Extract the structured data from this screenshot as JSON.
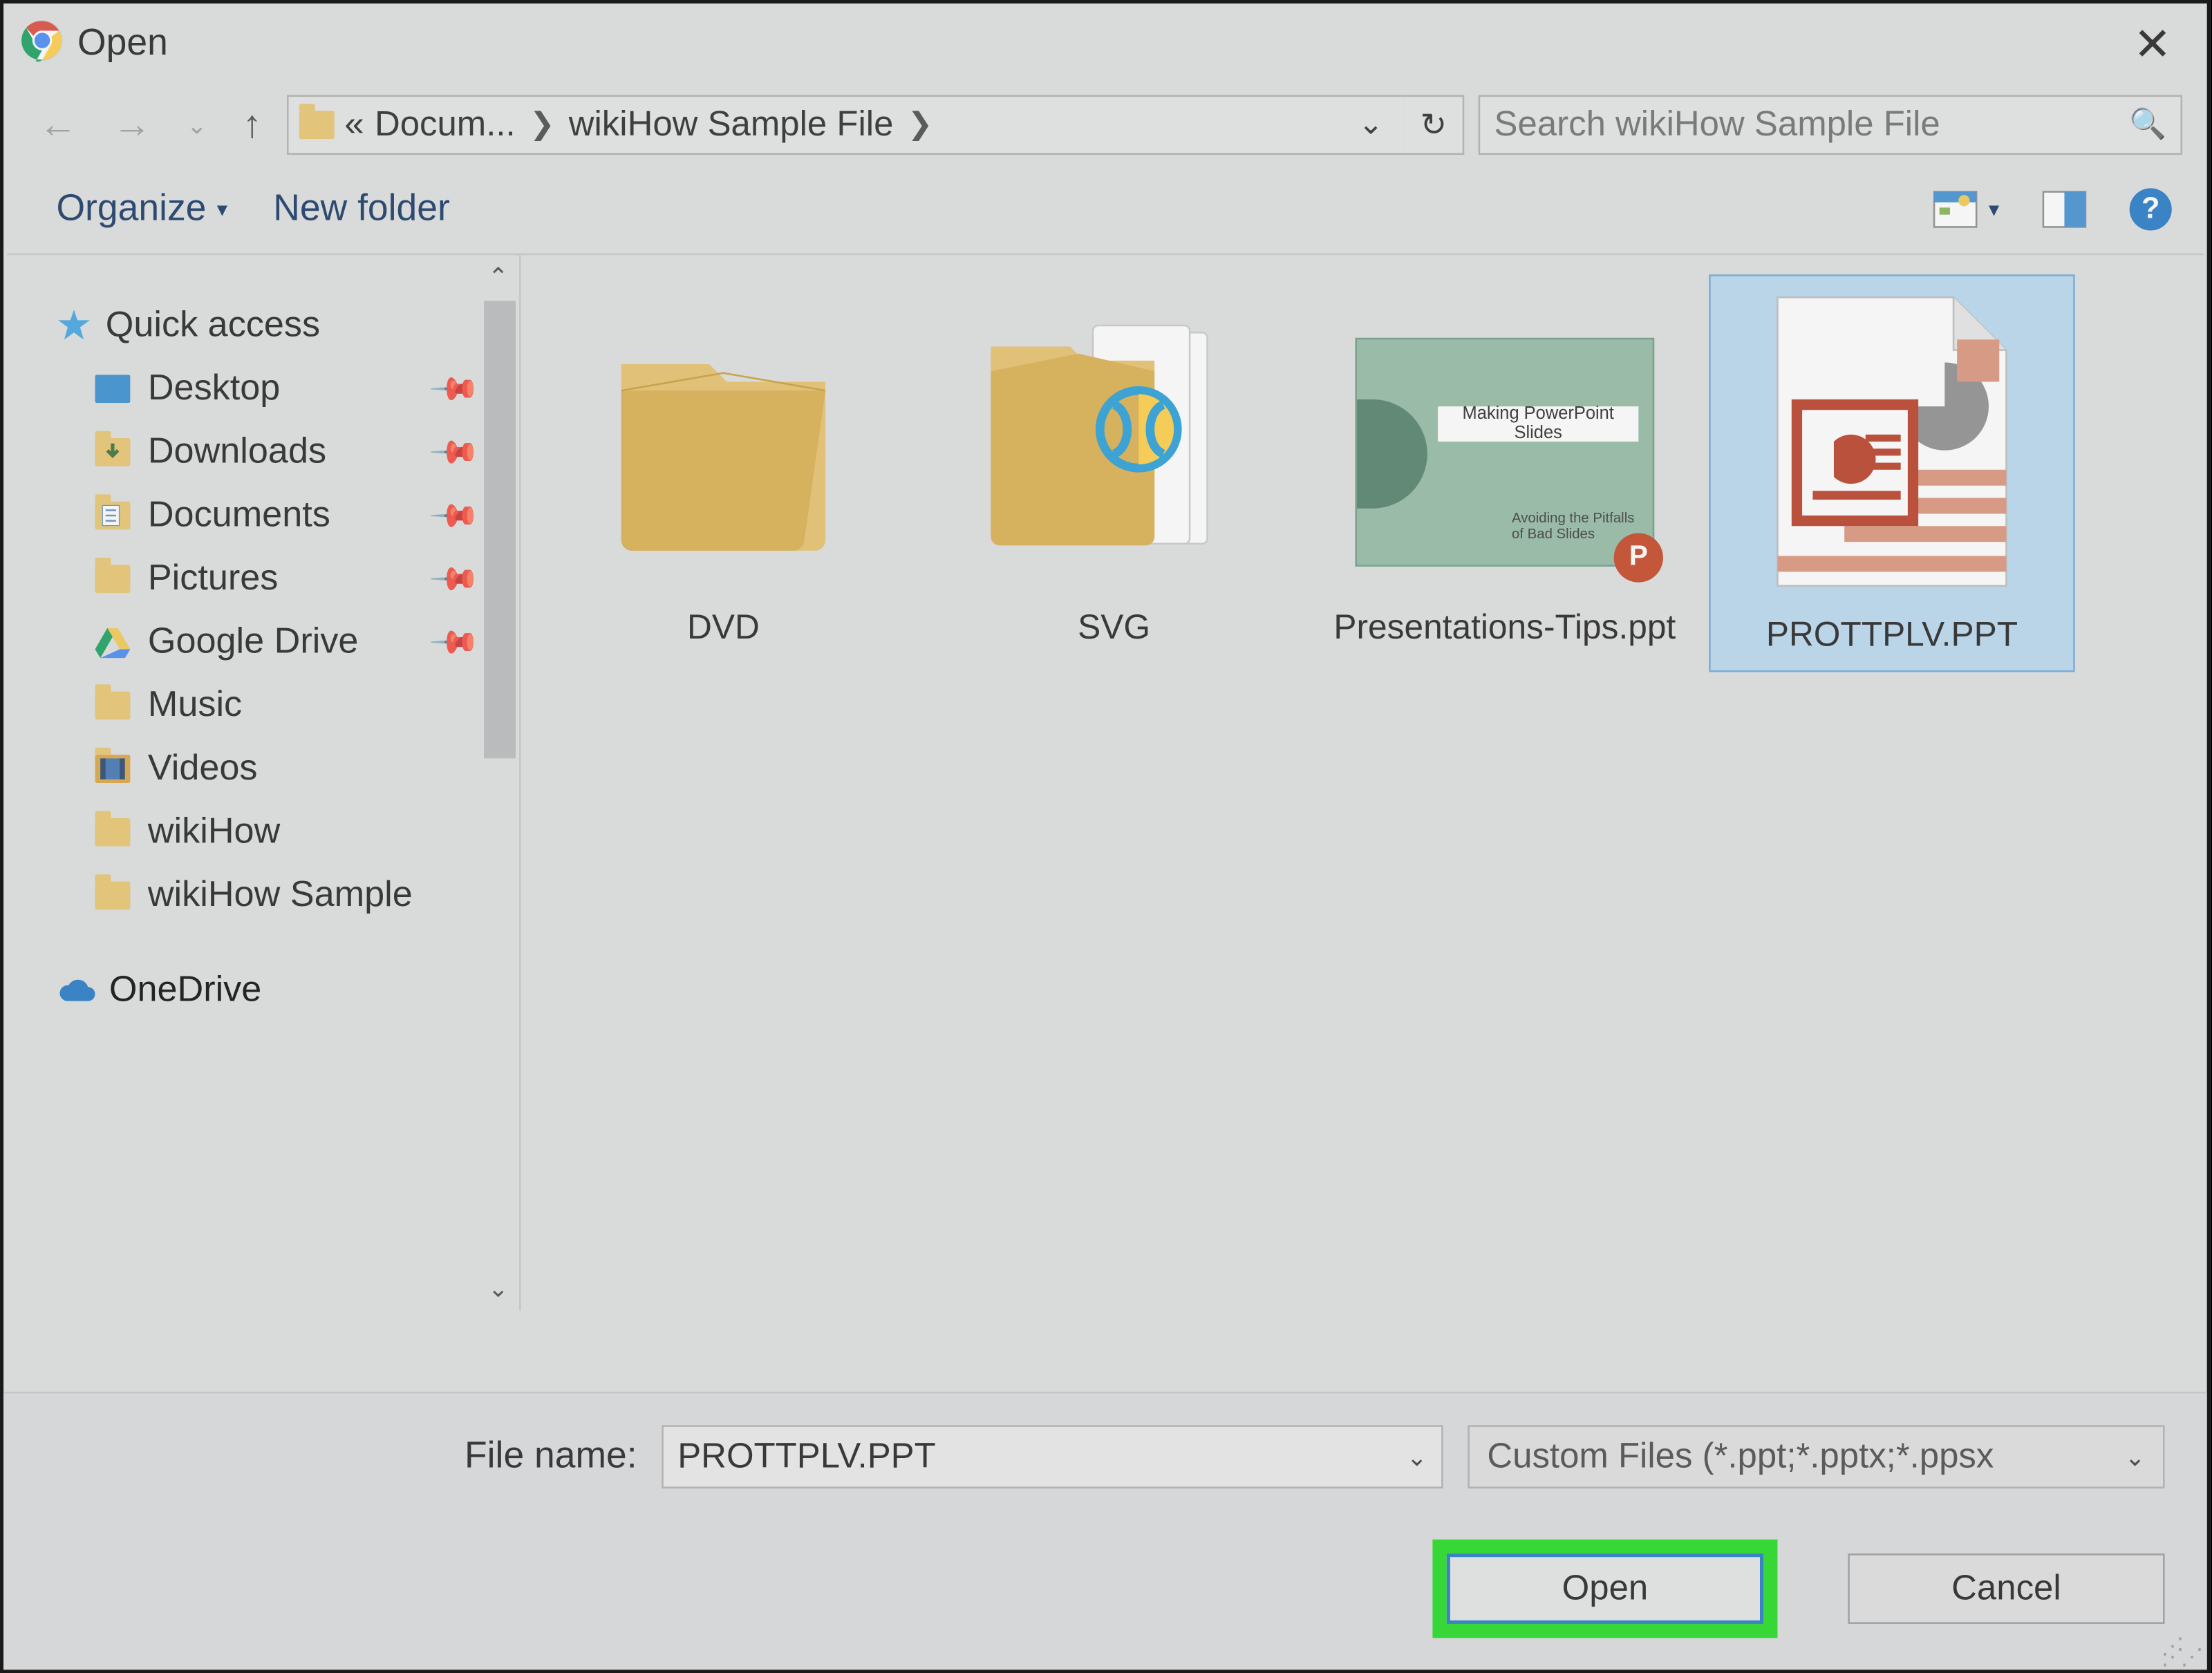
{
  "title": "Open",
  "breadcrumb": {
    "truncated": "«",
    "part1": "Docum...",
    "part2": "wikiHow Sample File"
  },
  "search_placeholder": "Search wikiHow Sample File",
  "toolbar": {
    "organize": "Organize",
    "newfolder": "New folder"
  },
  "sidebar": {
    "quick_access": "Quick access",
    "items": [
      "Desktop",
      "Downloads",
      "Documents",
      "Pictures",
      "Google Drive",
      "Music",
      "Videos",
      "wikiHow",
      "wikiHow Sample"
    ],
    "onedrive": "OneDrive"
  },
  "files": [
    {
      "name": "DVD"
    },
    {
      "name": "SVG"
    },
    {
      "name": "Presentations-Tips.ppt",
      "ppt_title": "Making PowerPoint Slides",
      "ppt_sub": "Avoiding the Pitfalls of Bad Slides"
    },
    {
      "name": "PROTTPLV.PPT",
      "selected": true
    }
  ],
  "filerow": {
    "label": "File name:",
    "value": "PROTTPLV.PPT",
    "filter": "Custom Files (*.ppt;*.pptx;*.ppsx"
  },
  "buttons": {
    "open": "Open",
    "cancel": "Cancel"
  }
}
